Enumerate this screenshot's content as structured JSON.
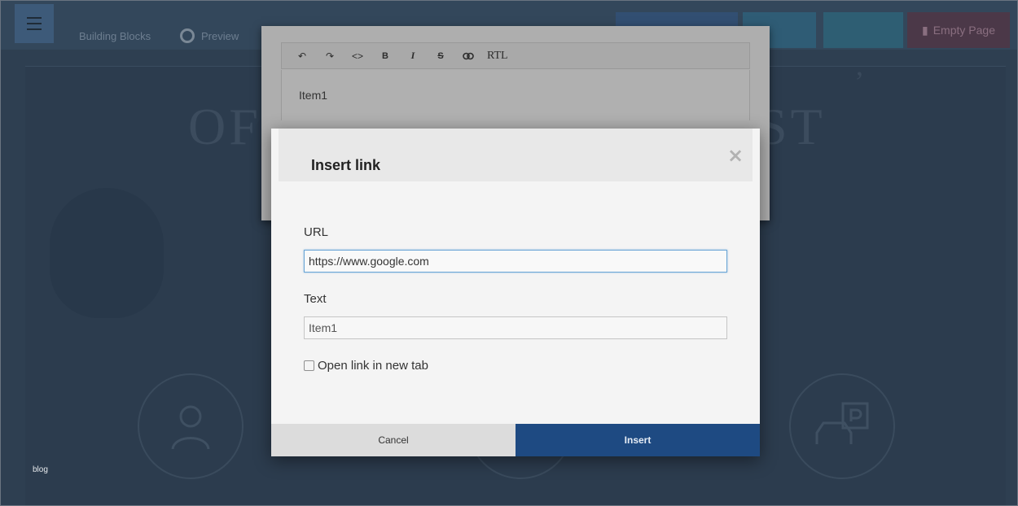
{
  "background": {
    "blocks_label": "Building Blocks",
    "preview_label": "Preview",
    "top_buttons": [
      "",
      "",
      "",
      "Empty Page"
    ],
    "hero_left": "OF",
    "hero_right": "ST",
    "hero_top": ",",
    "footer_label": "blog",
    "icons": [
      "person-icon",
      "car-icon",
      "parking-icon"
    ]
  },
  "editor": {
    "toolbar": {
      "undo": "↶",
      "redo": "↷",
      "code": "<>",
      "bold": "B",
      "italic": "I",
      "strike": "S",
      "link": "⊂⊃",
      "rtl": "RTL"
    },
    "content": "Item1"
  },
  "modal": {
    "title": "Insert link",
    "close_symbol": "×",
    "url_label": "URL",
    "url_value": "https://www.google.com",
    "text_label": "Text",
    "text_value": "Item1",
    "new_tab_label": "Open link in new tab",
    "new_tab_checked": false,
    "cancel_label": "Cancel",
    "insert_label": "Insert"
  },
  "colors": {
    "insert_button": "#1e4a82",
    "cancel_button": "#dcdcdc",
    "url_focus_border": "#6aa5d6"
  }
}
